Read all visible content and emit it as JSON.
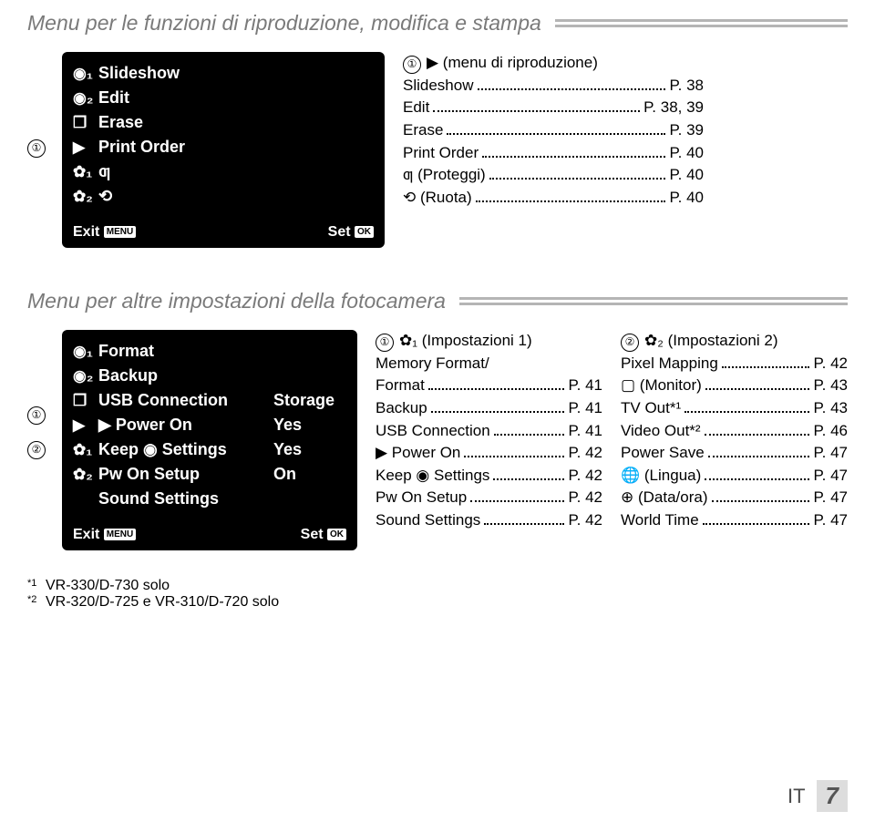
{
  "section1": {
    "title": "Menu per le funzioni di riproduzione, modifica e stampa",
    "menu": {
      "items": [
        {
          "icon": "◉₁",
          "label": "Slideshow",
          "value": ""
        },
        {
          "icon": "◉₂",
          "label": "Edit",
          "value": ""
        },
        {
          "icon": "❐",
          "label": "Erase",
          "value": ""
        },
        {
          "icon": "▶",
          "label": "Print Order",
          "value": ""
        },
        {
          "icon": "✿₁",
          "label": "ƣ",
          "value": ""
        },
        {
          "icon": "✿₂",
          "label": "⟲",
          "value": ""
        }
      ],
      "exit_label": "Exit",
      "exit_btn": "MENU",
      "set_label": "Set",
      "set_btn": "OK"
    },
    "index": {
      "num": "①",
      "header": "▶ (menu di riproduzione)",
      "lines": [
        {
          "text": "Slideshow",
          "page": "P. 38"
        },
        {
          "text": "Edit",
          "page": "P. 38, 39"
        },
        {
          "text": "Erase",
          "page": "P. 39"
        },
        {
          "text": "Print Order",
          "page": "P. 40"
        },
        {
          "text": "ƣ (Proteggi)",
          "page": "P. 40"
        },
        {
          "text": "⟲ (Ruota)",
          "page": "P. 40"
        }
      ]
    }
  },
  "section2": {
    "title": "Menu per altre impostazioni della fotocamera",
    "menu": {
      "items": [
        {
          "icon": "◉₁",
          "label": "Format",
          "value": ""
        },
        {
          "icon": "◉₂",
          "label": "Backup",
          "value": ""
        },
        {
          "icon": "❐",
          "label": "USB Connection",
          "value": "Storage"
        },
        {
          "icon": "▶",
          "label": "▶ Power On",
          "value": "Yes"
        },
        {
          "icon": "✿₁",
          "label": "Keep ◉ Settings",
          "value": "Yes"
        },
        {
          "icon": "✿₂",
          "label": "Pw On Setup",
          "value": "On"
        },
        {
          "icon": "",
          "label": "Sound Settings",
          "value": ""
        }
      ],
      "exit_label": "Exit",
      "exit_btn": "MENU",
      "set_label": "Set",
      "set_btn": "OK"
    },
    "col1": {
      "num": "①",
      "header": "✿₁ (Impostazioni 1)",
      "header2": "Memory Format/",
      "lines": [
        {
          "text": "Format",
          "page": "P. 41"
        },
        {
          "text": "Backup",
          "page": "P. 41"
        },
        {
          "text": "USB Connection",
          "page": "P. 41"
        },
        {
          "text": "▶ Power On",
          "page": "P. 42"
        },
        {
          "text": "Keep ◉ Settings",
          "page": "P. 42"
        },
        {
          "text": "Pw On Setup",
          "page": "P. 42"
        },
        {
          "text": "Sound Settings",
          "page": "P. 42"
        }
      ]
    },
    "col2": {
      "num": "②",
      "header": "✿₂ (Impostazioni 2)",
      "lines": [
        {
          "text": "Pixel Mapping",
          "page": "P. 42"
        },
        {
          "text": "▢ (Monitor)",
          "page": "P. 43"
        },
        {
          "text": "TV Out*¹",
          "page": "P. 43"
        },
        {
          "text": "Video Out*²",
          "page": "P. 46"
        },
        {
          "text": "Power Save",
          "page": "P. 47"
        },
        {
          "text": "🌐 (Lingua)",
          "page": "P. 47"
        },
        {
          "text": "⊕ (Data/ora)",
          "page": "P. 47"
        },
        {
          "text": "World Time",
          "page": "P. 47"
        }
      ]
    }
  },
  "footnotes": [
    {
      "star": "*1",
      "text": "VR-330/D-730 solo"
    },
    {
      "star": "*2",
      "text": "VR-320/D-725 e VR-310/D-720 solo"
    }
  ],
  "footer": {
    "lang": "IT",
    "page": "7"
  }
}
